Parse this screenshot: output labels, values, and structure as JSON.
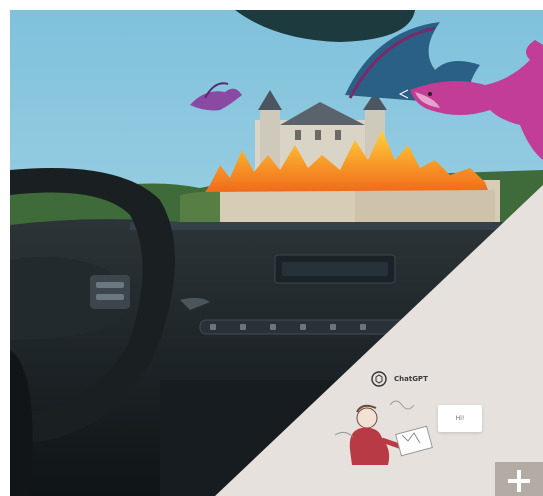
{
  "promo": {
    "chatgpt_label": "ChatGPT",
    "bubble_text": "Hi!",
    "expand_icon": "plus-icon"
  },
  "colors": {
    "sky": "#8fc6dc",
    "panel": "#e6e1dc",
    "dragon": "#c73e9a",
    "fire": "#f5a623",
    "button": "#b5aba5"
  }
}
